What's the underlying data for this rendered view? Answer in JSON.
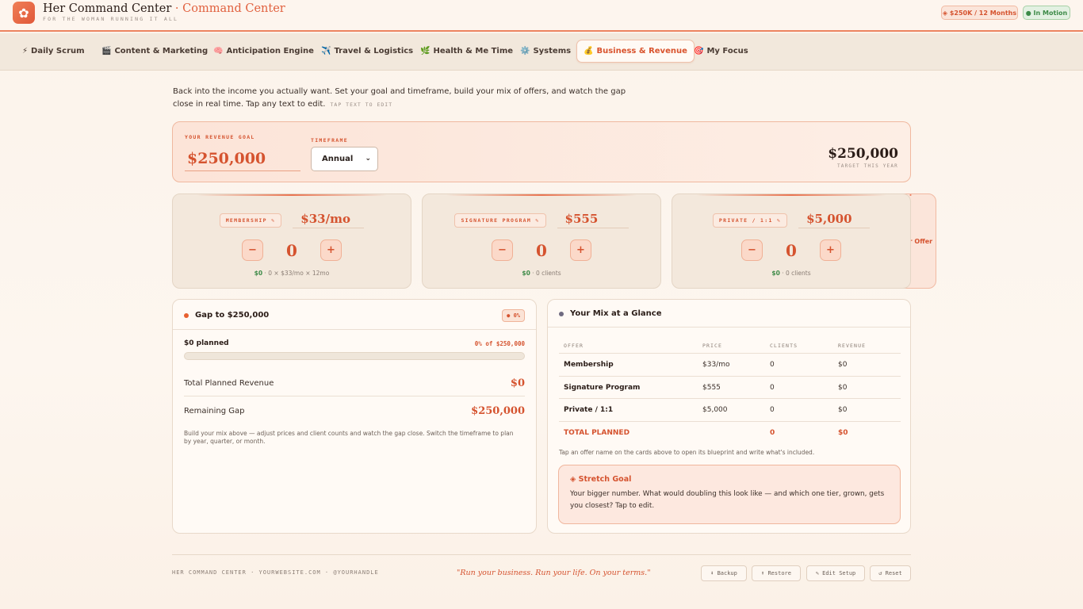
{
  "app": {
    "title_main": "Her Command Center",
    "title_sep": " · ",
    "title_accent": "Command Center",
    "subtitle": "FOR THE WOMAN RUNNING IT ALL",
    "logo_glyph": "✿"
  },
  "header_pills": {
    "offer": "✦ Your Offer",
    "revenue": "◈ $250K / 12 Months",
    "motion": "● In Motion"
  },
  "tabs": [
    {
      "icon": "⚡",
      "label": "Daily Scrum"
    },
    {
      "icon": "🎬",
      "label": "Content & Marketing"
    },
    {
      "icon": "🧠",
      "label": "Anticipation Engine"
    },
    {
      "icon": "✈️",
      "label": "Travel & Logistics"
    },
    {
      "icon": "🌿",
      "label": "Health & Me Time"
    },
    {
      "icon": "⚙️",
      "label": "Systems"
    },
    {
      "icon": "💰",
      "label": "Business & Revenue"
    },
    {
      "icon": "🎯",
      "label": "My Focus"
    }
  ],
  "intro": {
    "text": "Back into the income you actually want. Set your goal and timeframe, build your mix of offers, and watch the gap close in real time. Tap any text to edit.",
    "hint": "TAP TEXT TO EDIT"
  },
  "goal": {
    "label": "YOUR REVENUE GOAL",
    "value": "$250,000",
    "timeframe_label": "TIMEFRAME",
    "timeframe_value": "Annual",
    "target_value": "$250,000",
    "target_sub": "TARGET THIS YEAR"
  },
  "offers": [
    {
      "name": "MEMBERSHIP ✎",
      "price": "$33/mo",
      "minus": "−",
      "count": "0",
      "plus": "+",
      "amount": "$0",
      "detail": " · 0 × $33/mo × 12mo"
    },
    {
      "name": "SIGNATURE PROGRAM ✎",
      "price": "$555",
      "minus": "−",
      "count": "0",
      "plus": "+",
      "amount": "$0",
      "detail": " · 0 clients"
    },
    {
      "name": "PRIVATE / 1:1 ✎",
      "price": "$5,000",
      "minus": "−",
      "count": "0",
      "plus": "+",
      "amount": "$0",
      "detail": " · 0 clients"
    }
  ],
  "gap": {
    "title": "Gap to $250,000",
    "badge": "● 0%",
    "planned": "$0 planned",
    "planned_pct": "0% of $250,000",
    "progress_pct": 0,
    "total_label": "Total Planned Revenue",
    "total_value": "$0",
    "remaining_label": "Remaining Gap",
    "remaining_value": "$250,000",
    "note": "Build your mix above — adjust prices and client counts and watch the gap close. Switch the timeframe to plan by year, quarter, or month."
  },
  "mix": {
    "title": "Your Mix at a Glance",
    "columns": [
      "OFFER",
      "PRICE",
      "CLIENTS",
      "REVENUE"
    ],
    "rows": [
      {
        "offer": "Membership",
        "price": "$33/mo",
        "clients": "0",
        "revenue": "$0"
      },
      {
        "offer": "Signature Program",
        "price": "$555",
        "clients": "0",
        "revenue": "$0"
      },
      {
        "offer": "Private / 1:1",
        "price": "$5,000",
        "clients": "0",
        "revenue": "$0"
      }
    ],
    "total": {
      "label": "TOTAL PLANNED",
      "clients": "0",
      "revenue": "$0"
    },
    "note": "Tap an offer name on the cards above to open its blueprint and write what's included.",
    "stretch_title": "◈ Stretch Goal",
    "stretch_body": "Your bigger number. What would doubling this look like — and which one tier, grown, gets you closest? Tap to edit."
  },
  "footer": {
    "left": "HER COMMAND CENTER · YOURWEBSITE.COM · @YOURHANDLE",
    "quote": "\"Run your business. Run your life. On your terms.\"",
    "backup": "⬇ Backup",
    "restore": "⬆ Restore",
    "edit_setup": "✎ Edit Setup",
    "reset": "↺ Reset"
  },
  "colors": {
    "accent": "#e1613f",
    "positive": "#3c8a47",
    "background": "#fbf3eb"
  }
}
